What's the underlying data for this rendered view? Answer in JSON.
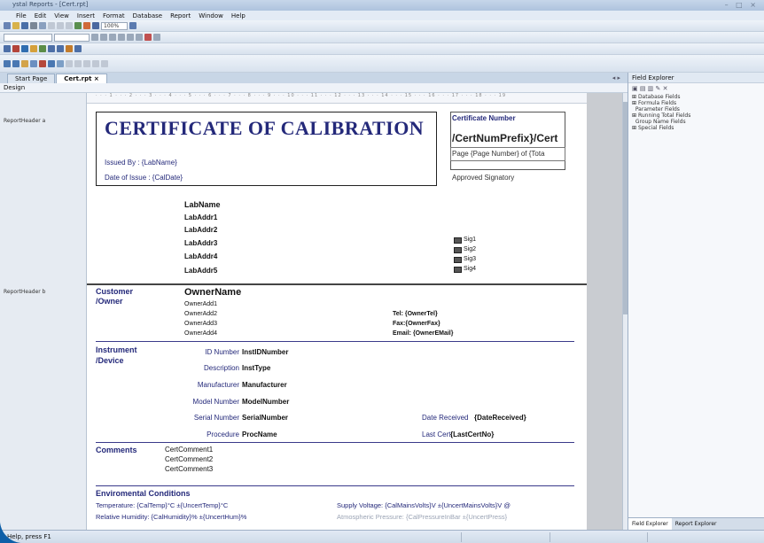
{
  "window": {
    "title": "ystal Reports - [Cert.rpt]"
  },
  "menu": [
    "File",
    "Edit",
    "View",
    "Insert",
    "Format",
    "Database",
    "Report",
    "Window",
    "Help"
  ],
  "toolbar": {
    "zoom": "100%"
  },
  "tabs": [
    {
      "label": "Start Page"
    },
    {
      "label": "Cert.rpt ×"
    }
  ],
  "design_label": "Design",
  "sections": {
    "rha": "ReportHeader a",
    "rhb": "ReportHeader b"
  },
  "header": {
    "title": "CERTIFICATE OF CALIBRATION",
    "issued_by": "Issued By : {LabName}",
    "date_issue": "Date of Issue : {CalDate}",
    "cert_number_label": "Certificate Number",
    "cert_number_value": "/CertNumPrefix}/Cert",
    "page_info": "Page {Page Number} of {Tota",
    "approved": "Approved Signatory"
  },
  "lab": [
    "LabName",
    "LabAddr1",
    "LabAddr2",
    "LabAddr3",
    "LabAddr4",
    "LabAddr5"
  ],
  "sigs": [
    "Sig1",
    "Sig2",
    "Sig3",
    "Sig4"
  ],
  "customer": {
    "label1": "Customer",
    "label2": "/Owner",
    "name": "OwnerName",
    "adds": [
      "OwnerAdd1",
      "OwnerAdd2",
      "OwnerAdd3",
      "OwnerAdd4"
    ],
    "tel": "Tel: {OwnerTel}",
    "fax": "Fax:{OwnerFax}",
    "email": "Email: {OwnerEMail}"
  },
  "instrument": {
    "label1": "Instrument",
    "label2": "/Device",
    "rows": [
      {
        "label": "ID Number",
        "value": "InstIDNumber"
      },
      {
        "label": "Description",
        "value": "InstType"
      },
      {
        "label": "Manufacturer",
        "value": "Manufacturer"
      },
      {
        "label": "Model Number",
        "value": "ModelNumber"
      },
      {
        "label": "Serial Number",
        "value": "SerialNumber"
      },
      {
        "label": "Procedure",
        "value": "ProcName"
      }
    ],
    "date_received_label": "Date Received",
    "date_received_value": "{DateReceived}",
    "last_cert_label": "Last Cert",
    "last_cert_value": "{LastCertNo}"
  },
  "comments": {
    "label": "Comments",
    "lines": [
      "CertComment1",
      "CertComment2",
      "CertComment3"
    ]
  },
  "env": {
    "title": "Enviromental Conditions",
    "temp": "Temperature: {CalTemp}°C ±{UncertTemp}°C",
    "humidity": "Relative Humidity: {CalHumidity}% ±{UncertHum}%",
    "voltage": "Supply Voltage: {CalMainsVolts}V ±{UncertMainsVolts}V @",
    "pressure": "Atmospheric Pressure: {CalPressureInBar ±{UncertPress}"
  },
  "field_explorer": {
    "title": "Field Explorer",
    "items": [
      "Database Fields",
      "Formula Fields",
      "Parameter Fields",
      "Running Total Fields",
      "Group Name Fields",
      "Special Fields"
    ],
    "tabs": [
      "Field Explorer",
      "Report Explorer"
    ]
  },
  "status": "Help, press F1"
}
